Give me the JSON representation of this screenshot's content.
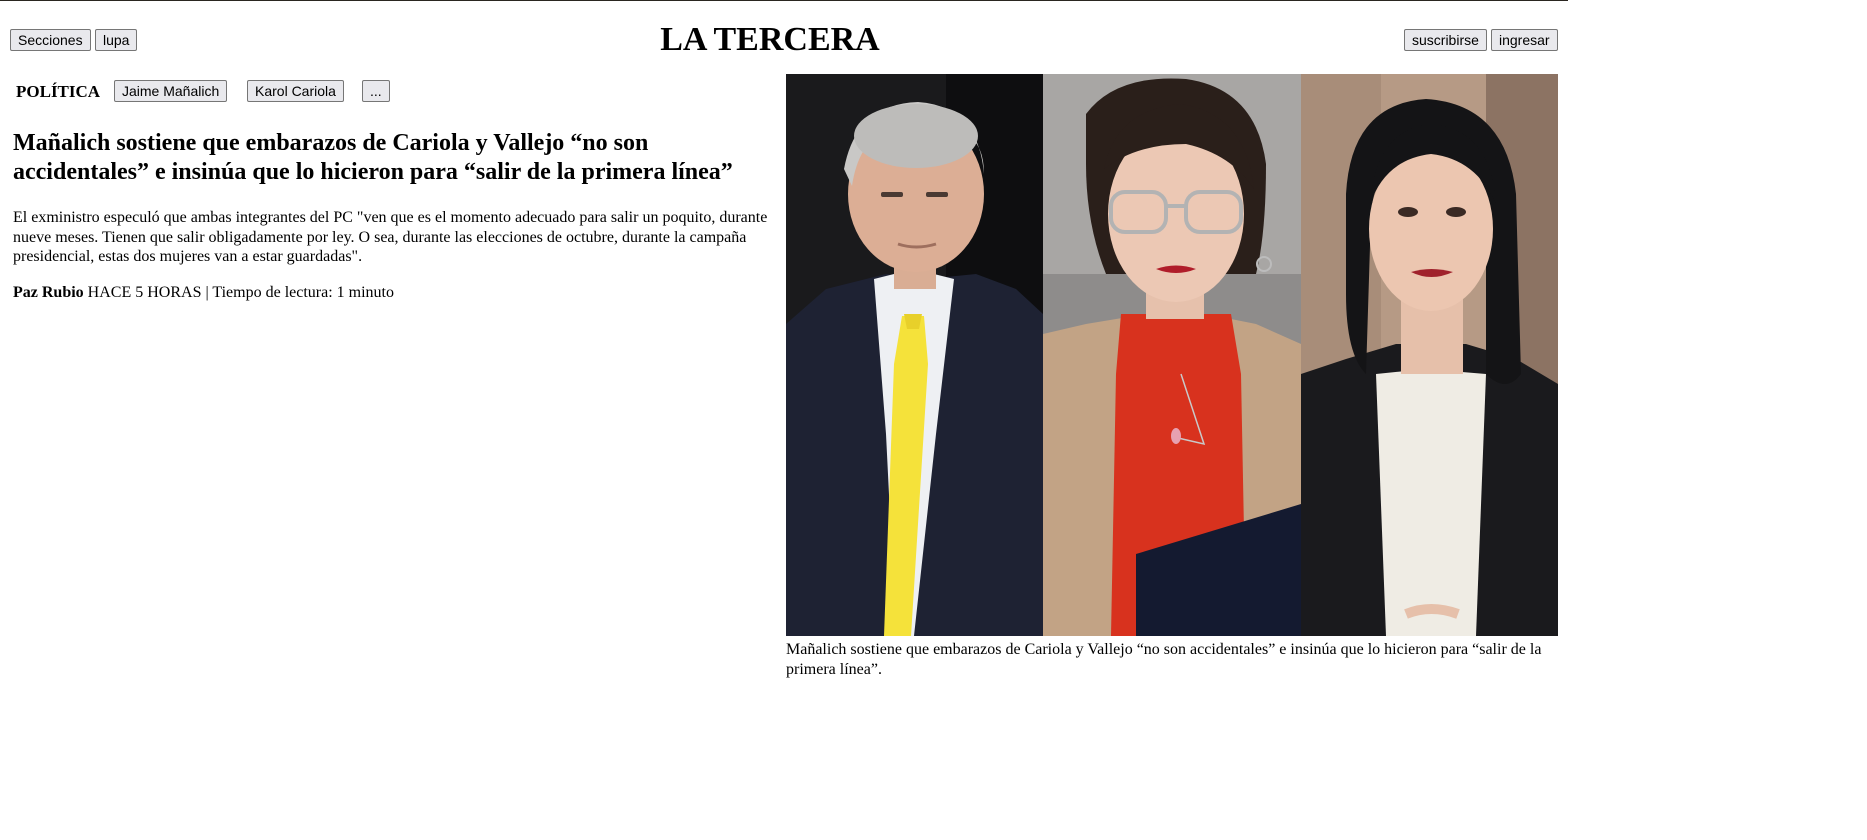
{
  "header": {
    "sections_button": "Secciones",
    "search_button": "lupa",
    "logo": "LA TERCERA",
    "subscribe_button": "suscribirse",
    "login_button": "ingresar"
  },
  "tags": {
    "section": "POLÍTICA",
    "items": [
      "Jaime Mañalich",
      "Karol Cariola",
      "..."
    ]
  },
  "article": {
    "headline": "Mañalich sostiene que embarazos de Cariola y Vallejo “no son accidentales” e insinúa que lo hicieron para “salir de la primera línea”",
    "summary": "El exministro especuló que ambas integrantes del PC \"ven que es el momento adecuado para salir un poquito, durante nueve meses. Tienen que salir obligadamente por ley. O sea, durante las elecciones de octubre, durante la campaña presidencial, estas dos mujeres van a estar guardadas\".",
    "author": "Paz Rubio",
    "time": "HACE 5 HORAS",
    "separator": "|",
    "reading_time": "Tiempo de lectura: 1 minuto",
    "image_caption": "Mañalich sostiene que embarazos de Cariola y Vallejo “no son accidentales” e insinúa que lo hicieron para “salir de la primera línea”."
  },
  "colors": {
    "button_bg": "#e9e9ed",
    "button_border": "#767676",
    "top_rule": "#2a2620",
    "tie_yellow": "#f5e23a",
    "sweater_red": "#d8321e"
  }
}
